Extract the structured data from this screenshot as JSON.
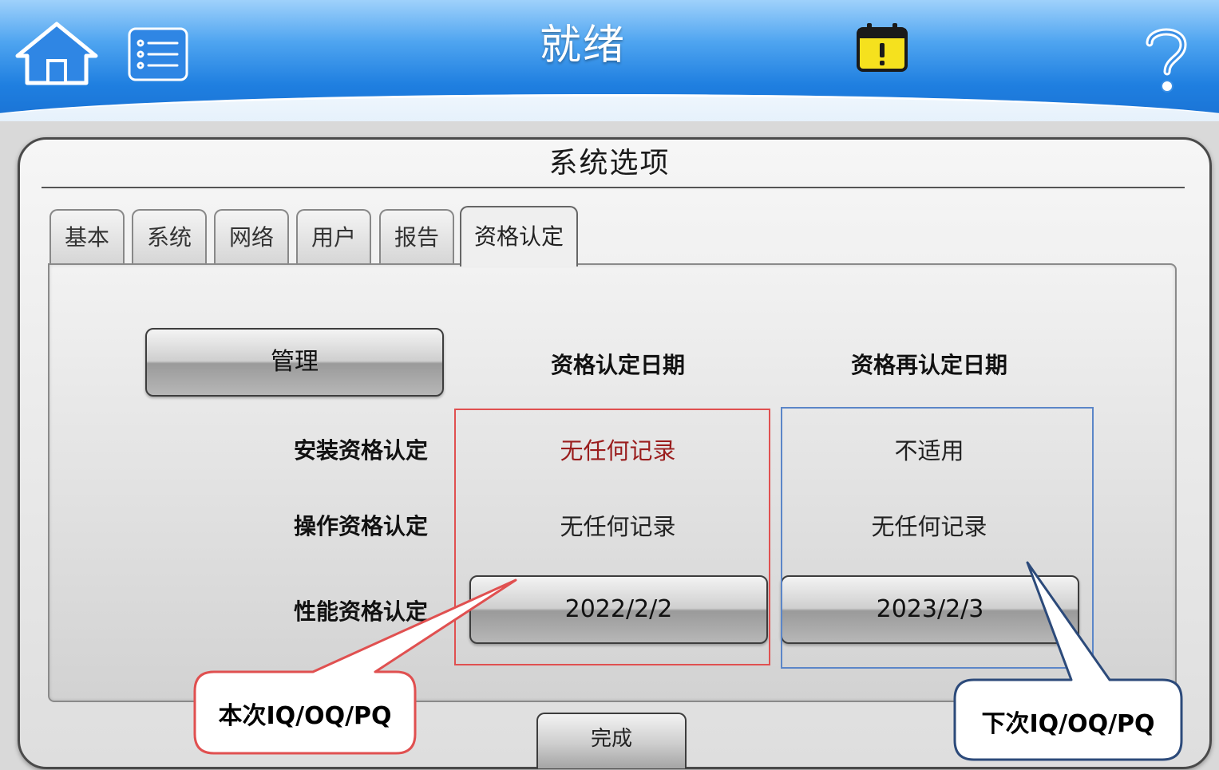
{
  "header": {
    "title": "就绪",
    "icons": [
      "home-icon",
      "menu-list-icon",
      "calendar-alert-icon",
      "help-icon"
    ]
  },
  "panel": {
    "title": "系统选项"
  },
  "tabs": [
    {
      "label": "基本",
      "active": false
    },
    {
      "label": "系统",
      "active": false
    },
    {
      "label": "网络",
      "active": false
    },
    {
      "label": "用户",
      "active": false
    },
    {
      "label": "报告",
      "active": false
    },
    {
      "label": "资格认定",
      "active": true
    }
  ],
  "qualification": {
    "manage_label": "管理",
    "col_qual_date": "资格认定日期",
    "col_requal_date": "资格再认定日期",
    "rows": [
      {
        "label": "安装资格认定",
        "qual": "无任何记录",
        "requal": "不适用"
      },
      {
        "label": "操作资格认定",
        "qual": "无任何记录",
        "requal": "无任何记录"
      },
      {
        "label": "性能资格认定",
        "qual": "2022/2/2",
        "requal": "2023/2/3"
      }
    ]
  },
  "footer": {
    "done_label": "完成"
  },
  "callouts": {
    "current": "本次IQ/OQ/PQ",
    "next": "下次IQ/OQ/PQ"
  },
  "colors": {
    "header_blue": "#1f7fe0",
    "callout_red": "#e05050",
    "callout_blue": "#2c4a7a",
    "no_record_red": "#9a1d1d",
    "calendar_yellow": "#f5e11e"
  }
}
